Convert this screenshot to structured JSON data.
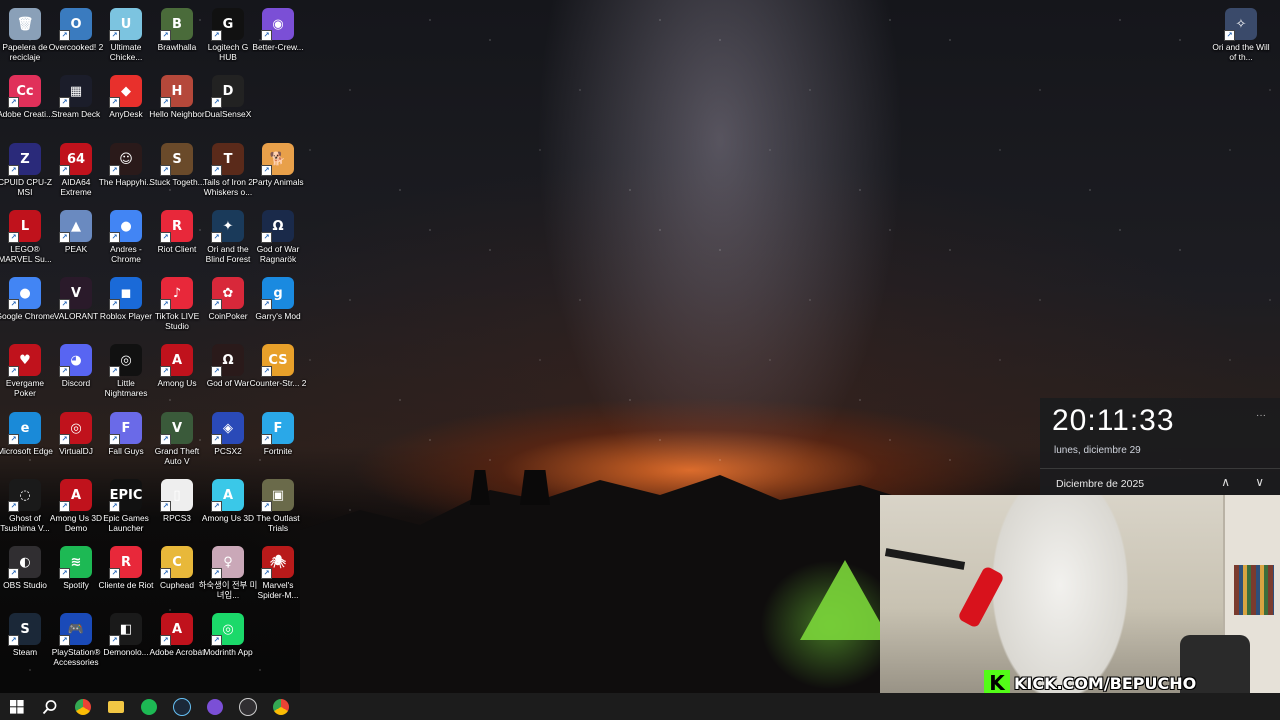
{
  "desktop": {
    "icons": [
      {
        "label": "Papelera de reciclaje",
        "glyph": "🗑",
        "color": "#8aa0b8"
      },
      {
        "label": "Overcooked! 2",
        "glyph": "O",
        "color": "#3a7bbf"
      },
      {
        "label": "Ultimate Chicke...",
        "glyph": "U",
        "color": "#7cc4e0"
      },
      {
        "label": "Brawlhalla",
        "glyph": "B",
        "color": "#4a6b3a"
      },
      {
        "label": "Logitech G HUB",
        "glyph": "G",
        "color": "#111111"
      },
      {
        "label": "Better-Crew...",
        "glyph": "◉",
        "color": "#7b4fd6"
      },
      {
        "label": "Adobe Creati...",
        "glyph": "Cc",
        "color": "#e0305a"
      },
      {
        "label": "Stream Deck",
        "glyph": "▦",
        "color": "#1b1d2a"
      },
      {
        "label": "AnyDesk",
        "glyph": "◆",
        "color": "#e8302c"
      },
      {
        "label": "Hello Neighbor",
        "glyph": "H",
        "color": "#b5483a"
      },
      {
        "label": "DualSenseX",
        "glyph": "D",
        "color": "#222222"
      },
      {
        "label": "CPUID CPU-Z MSI",
        "glyph": "Z",
        "color": "#2a2a7a"
      },
      {
        "label": "AIDA64 Extreme",
        "glyph": "64",
        "color": "#c0121c"
      },
      {
        "label": "The Happyhi...",
        "glyph": "☺",
        "color": "#2a1a1a"
      },
      {
        "label": "Stuck Togeth...",
        "glyph": "S",
        "color": "#6a4a2a"
      },
      {
        "label": "Tails of Iron 2 Whiskers o...",
        "glyph": "T",
        "color": "#5a2a1a"
      },
      {
        "label": "Party Animals",
        "glyph": "🐕",
        "color": "#e8a04a"
      },
      {
        "label": "LEGO® MARVEL Su...",
        "glyph": "L",
        "color": "#c0121c"
      },
      {
        "label": "PEAK",
        "glyph": "▲",
        "color": "#6a8ac0"
      },
      {
        "label": "Andres - Chrome",
        "glyph": "●",
        "color": "#4285f4"
      },
      {
        "label": "Riot Client",
        "glyph": "R",
        "color": "#e8283a"
      },
      {
        "label": "Ori and the Blind Forest",
        "glyph": "✦",
        "color": "#1a3a5a"
      },
      {
        "label": "God of War Ragnarök",
        "glyph": "Ω",
        "color": "#1a2a4a"
      },
      {
        "label": "Google Chrome",
        "glyph": "●",
        "color": "#4285f4"
      },
      {
        "label": "VALORANT",
        "glyph": "V",
        "color": "#2a1a2a"
      },
      {
        "label": "Roblox Player",
        "glyph": "◼",
        "color": "#1a6ad8"
      },
      {
        "label": "TikTok LIVE Studio",
        "glyph": "♪",
        "color": "#e8283a"
      },
      {
        "label": "CoinPoker",
        "glyph": "✿",
        "color": "#d8283a"
      },
      {
        "label": "Garry's Mod",
        "glyph": "g",
        "color": "#1a8ae0"
      },
      {
        "label": "Evergame Poker",
        "glyph": "♥",
        "color": "#c0121c"
      },
      {
        "label": "Discord",
        "glyph": "◕",
        "color": "#5865f2"
      },
      {
        "label": "Little Nightmares",
        "glyph": "◎",
        "color": "#111111"
      },
      {
        "label": "Among Us",
        "glyph": "A",
        "color": "#c0121c"
      },
      {
        "label": "God of War",
        "glyph": "Ω",
        "color": "#2a1a1a"
      },
      {
        "label": "Counter-Str... 2",
        "glyph": "CS",
        "color": "#e8a02a"
      },
      {
        "label": "Microsoft Edge",
        "glyph": "e",
        "color": "#1a8ad8"
      },
      {
        "label": "VirtualDJ",
        "glyph": "◎",
        "color": "#c0121c"
      },
      {
        "label": "Fall Guys",
        "glyph": "F",
        "color": "#6a6ae8"
      },
      {
        "label": "Grand Theft Auto V",
        "glyph": "V",
        "color": "#3a5a3a"
      },
      {
        "label": "PCSX2",
        "glyph": "◈",
        "color": "#2a4ab8"
      },
      {
        "label": "Fortnite",
        "glyph": "F",
        "color": "#2aa8e8"
      },
      {
        "label": "Ghost of Tsushima V...",
        "glyph": "◌",
        "color": "#1a1a1a"
      },
      {
        "label": "Among Us 3D Demo",
        "glyph": "A",
        "color": "#c0121c"
      },
      {
        "label": "Epic Games Launcher",
        "glyph": "EPIC",
        "color": "#111111"
      },
      {
        "label": "RPCS3",
        "glyph": "▯",
        "color": "#eeeeee"
      },
      {
        "label": "Among Us 3D",
        "glyph": "A",
        "color": "#3ac8e8"
      },
      {
        "label": "The Outlast Trials",
        "glyph": "▣",
        "color": "#6a6a4a"
      },
      {
        "label": "OBS Studio",
        "glyph": "◐",
        "color": "#302e31"
      },
      {
        "label": "Spotify",
        "glyph": "≋",
        "color": "#1db954"
      },
      {
        "label": "Cliente de Riot",
        "glyph": "R",
        "color": "#e8283a"
      },
      {
        "label": "Cuphead",
        "glyph": "C",
        "color": "#e8b83a"
      },
      {
        "label": "하숙생이 전부 미녀입...",
        "glyph": "♀",
        "color": "#caa8b8"
      },
      {
        "label": "Marvel's Spider-M...",
        "glyph": "🕷",
        "color": "#b81a1a"
      },
      {
        "label": "Steam",
        "glyph": "S",
        "color": "#1b2838"
      },
      {
        "label": "PlayStation® Accessories",
        "glyph": "🎮",
        "color": "#1a4ab8"
      },
      {
        "label": "Demonolo...",
        "glyph": "◧",
        "color": "#1a1a1a"
      },
      {
        "label": "Adobe Acrobat",
        "glyph": "A",
        "color": "#c0121c"
      },
      {
        "label": "Modrinth App",
        "glyph": "◎",
        "color": "#1bd96a"
      }
    ],
    "right_icon": {
      "label": "Ori and the Will of th...",
      "glyph": "✧",
      "color": "#3a4a6a"
    }
  },
  "clock_flyout": {
    "time": "20:11:33",
    "date": "lunes, diciembre 29",
    "month": "Diciembre de 2025",
    "more": "···",
    "prev": "∧",
    "next": "∨"
  },
  "taskbar": {
    "items": [
      {
        "name": "start",
        "color": "#ffffff"
      },
      {
        "name": "search",
        "color": "#ffffff"
      },
      {
        "name": "chrome",
        "color": "#4285f4"
      },
      {
        "name": "file-explorer",
        "color": "#f2c744"
      },
      {
        "name": "spotify",
        "color": "#1db954"
      },
      {
        "name": "steam",
        "color": "#66c0f4"
      },
      {
        "name": "better-crewlink",
        "color": "#7b4fd6"
      },
      {
        "name": "obs",
        "color": "#cccccc"
      },
      {
        "name": "chrome-2",
        "color": "#ea4335"
      }
    ]
  },
  "webcam": {
    "overlay_text": "KICK.COM/BEPUCHO",
    "logo": "K"
  }
}
